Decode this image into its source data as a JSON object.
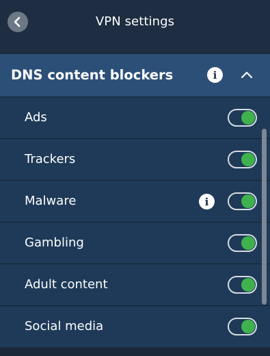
{
  "header": {
    "title": "VPN settings"
  },
  "section": {
    "title": "DNS content blockers",
    "expanded": true
  },
  "items": [
    {
      "label": "Ads",
      "enabled": true,
      "has_info": false
    },
    {
      "label": "Trackers",
      "enabled": true,
      "has_info": false
    },
    {
      "label": "Malware",
      "enabled": true,
      "has_info": true
    },
    {
      "label": "Gambling",
      "enabled": true,
      "has_info": false
    },
    {
      "label": "Adult content",
      "enabled": true,
      "has_info": false
    },
    {
      "label": "Social media",
      "enabled": true,
      "has_info": false
    }
  ],
  "icons": {
    "info_glyph": "i",
    "back": "chevron-left-icon",
    "collapse": "chevron-up-icon"
  },
  "colors": {
    "background": "#1e2d41",
    "section_header": "#2c4f77",
    "row": "#1e3a58",
    "toggle_on": "#3fb24d"
  }
}
